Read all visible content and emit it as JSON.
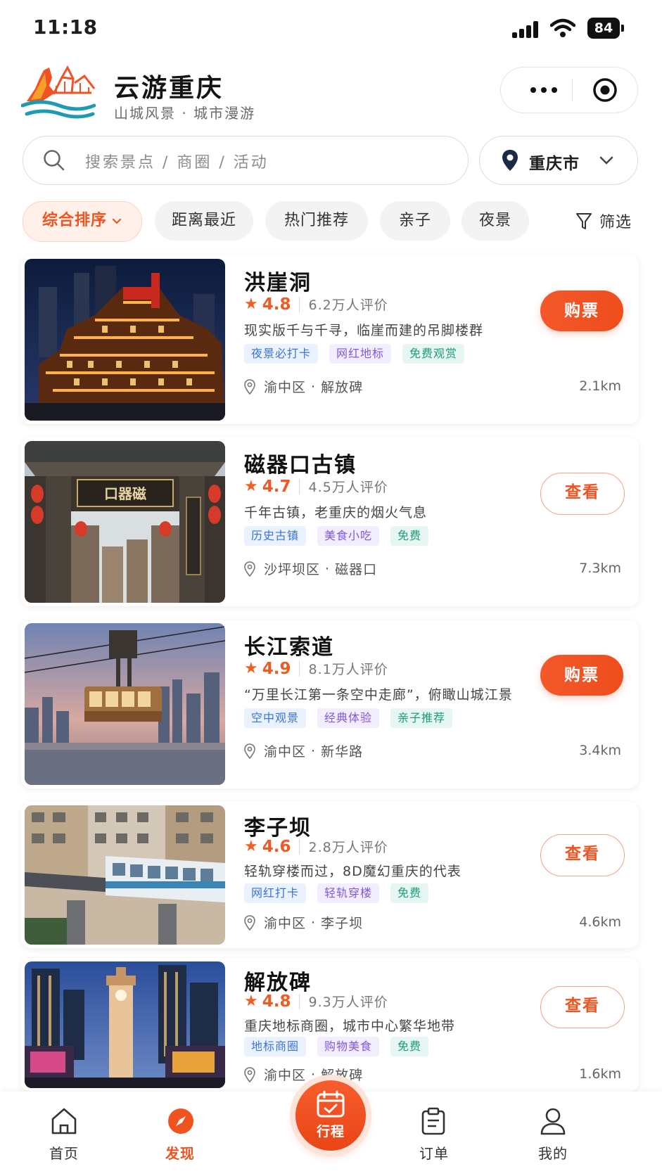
{
  "status_bar": {
    "time": "11:18",
    "battery": "84"
  },
  "header": {
    "title": "云游重庆",
    "subtitle": "山城风景 · 城市漫游"
  },
  "search": {
    "placeholder": "搜索景点 / 商圈 / 活动"
  },
  "city_selector": {
    "label": "重庆市"
  },
  "filters": [
    {
      "label": "综合排序",
      "active": true
    },
    {
      "label": "距离最近",
      "active": false
    },
    {
      "label": "热门推荐",
      "active": false
    },
    {
      "label": "亲子",
      "active": false
    },
    {
      "label": "夜景",
      "active": false
    }
  ],
  "filter_button": "筛选",
  "colors": {
    "accent": "#ee5320"
  },
  "spots": [
    {
      "name": "洪崖洞",
      "rating": "4.8",
      "reviews": "6.2万人评价",
      "desc": "现实版千与千寻，临崖而建的吊脚楼群",
      "tags": [
        "夜景必打卡",
        "网红地标",
        "免费观赏"
      ],
      "district": "渝中区",
      "area": "解放碑",
      "distance": "2.1km",
      "action": "购票",
      "action_style": "primary"
    },
    {
      "name": "磁器口古镇",
      "rating": "4.7",
      "reviews": "4.5万人评价",
      "desc": "千年古镇，老重庆的烟火气息",
      "tags": [
        "历史古镇",
        "美食小吃",
        "免费"
      ],
      "district": "沙坪坝区",
      "area": "磁器口",
      "distance": "7.3km",
      "action": "查看",
      "action_style": "outline",
      "sign_text": "口器磁"
    },
    {
      "name": "长江索道",
      "rating": "4.9",
      "reviews": "8.1万人评价",
      "desc": "“万里长江第一条空中走廊”，俯瞰山城江景",
      "tags": [
        "空中观景",
        "经典体验",
        "亲子推荐"
      ],
      "district": "渝中区",
      "area": "新华路",
      "distance": "3.4km",
      "action": "购票",
      "action_style": "primary"
    },
    {
      "name": "李子坝",
      "rating": "4.6",
      "reviews": "2.8万人评价",
      "desc": "轻轨穿楼而过，8D魔幻重庆的代表",
      "tags": [
        "网红打卡",
        "轻轨穿楼",
        "免费"
      ],
      "district": "渝中区",
      "area": "李子坝",
      "distance": "4.6km",
      "action": "查看",
      "action_style": "outline"
    },
    {
      "name": "解放碑",
      "rating": "4.8",
      "reviews": "9.3万人评价",
      "desc": "重庆地标商圈，城市中心繁华地带",
      "tags": [
        "地标商圈",
        "购物美食",
        "免费"
      ],
      "district": "渝中区",
      "area": "解放碑",
      "distance": "1.6km",
      "action": "查看",
      "action_style": "outline"
    }
  ],
  "nav": [
    {
      "label": "首页",
      "icon": "home-icon",
      "active": false
    },
    {
      "label": "发现",
      "icon": "compass-icon",
      "active": true
    },
    {
      "label": "行程",
      "icon": "calendar-icon",
      "active": false
    },
    {
      "label": "订单",
      "icon": "clipboard-icon",
      "active": false
    },
    {
      "label": "我的",
      "icon": "user-icon",
      "active": false
    }
  ]
}
